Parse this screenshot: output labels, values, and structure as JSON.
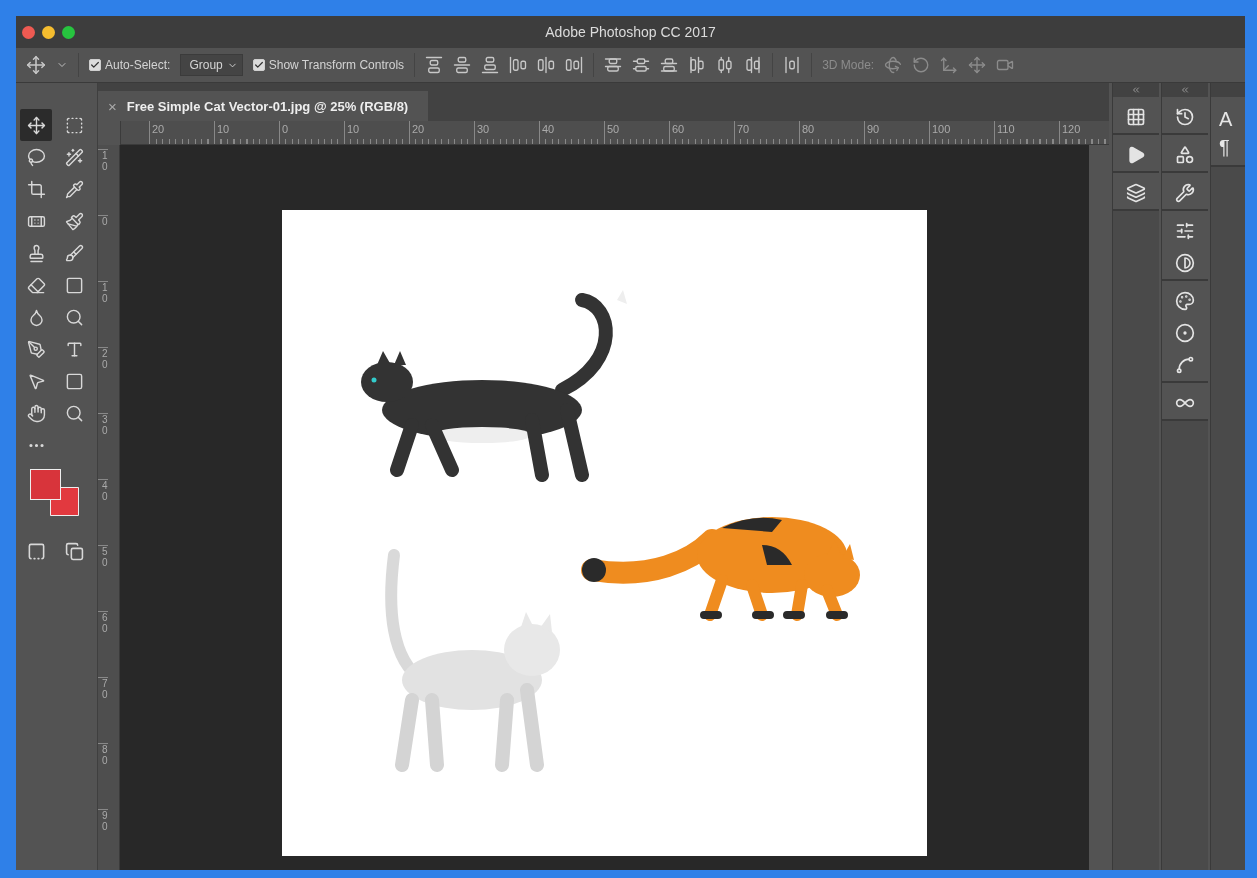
{
  "window": {
    "title": "Adobe Photoshop CC 2017"
  },
  "options_bar": {
    "auto_select": {
      "label": "Auto-Select:",
      "checked": true
    },
    "auto_select_target": "Group",
    "show_transform_controls": {
      "label": "Show Transform Controls",
      "checked": true
    },
    "mode_label": "3D Mode:"
  },
  "document_tab": {
    "close": "×",
    "title": "Free Simple Cat Vector-01.jpg @ 25% (RGB/8)"
  },
  "rulers": {
    "horizontal": [
      "20",
      "10",
      "0",
      "10",
      "20",
      "30",
      "40",
      "50",
      "60",
      "70",
      "80",
      "90",
      "100",
      "110",
      "120"
    ],
    "vertical": [
      "10",
      "0",
      "10",
      "20",
      "30",
      "40",
      "50",
      "60",
      "70",
      "80",
      "90"
    ]
  },
  "color_swatches": [
    {
      "color": "#d8343b"
    },
    {
      "color": "#e2393f"
    }
  ],
  "side_panel": {
    "items": [
      "A",
      "¶"
    ]
  }
}
